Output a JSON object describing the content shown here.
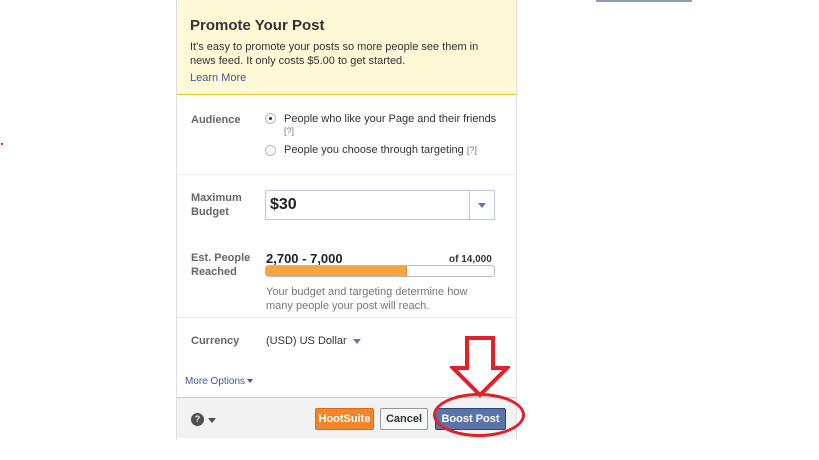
{
  "promo": {
    "title": "Promote Your Post",
    "description": "It's easy to promote your posts so more people see them in news feed. It only costs $5.00 to get started.",
    "learn_more": "Learn More"
  },
  "audience": {
    "label": "Audience",
    "options": [
      {
        "label": "People who like your Page and their friends",
        "help": "[?]",
        "selected": true
      },
      {
        "label": "People you choose through targeting",
        "help": "[?]",
        "selected": false
      }
    ]
  },
  "budget": {
    "label_line1": "Maximum",
    "label_line2": "Budget",
    "value": "$30"
  },
  "reach": {
    "label_line1": "Est. People",
    "label_line2": "Reached",
    "range": "2,700 - 7,000",
    "of_total": "of 14,000",
    "progress_fraction": 0.62,
    "note": "Your budget and targeting determine how many people your post will reach."
  },
  "currency": {
    "label": "Currency",
    "value": "(USD) US Dollar"
  },
  "more_options": "More Options",
  "footer": {
    "help_glyph": "?",
    "hootsuite": "HootSuite",
    "cancel": "Cancel",
    "boost": "Boost Post"
  },
  "colors": {
    "promo_bg": "#fff9d7",
    "progress": "#f6a541",
    "boost_button": "#5b74a8",
    "hootsuite_button": "#f2852a",
    "annotation": "#e12028"
  }
}
